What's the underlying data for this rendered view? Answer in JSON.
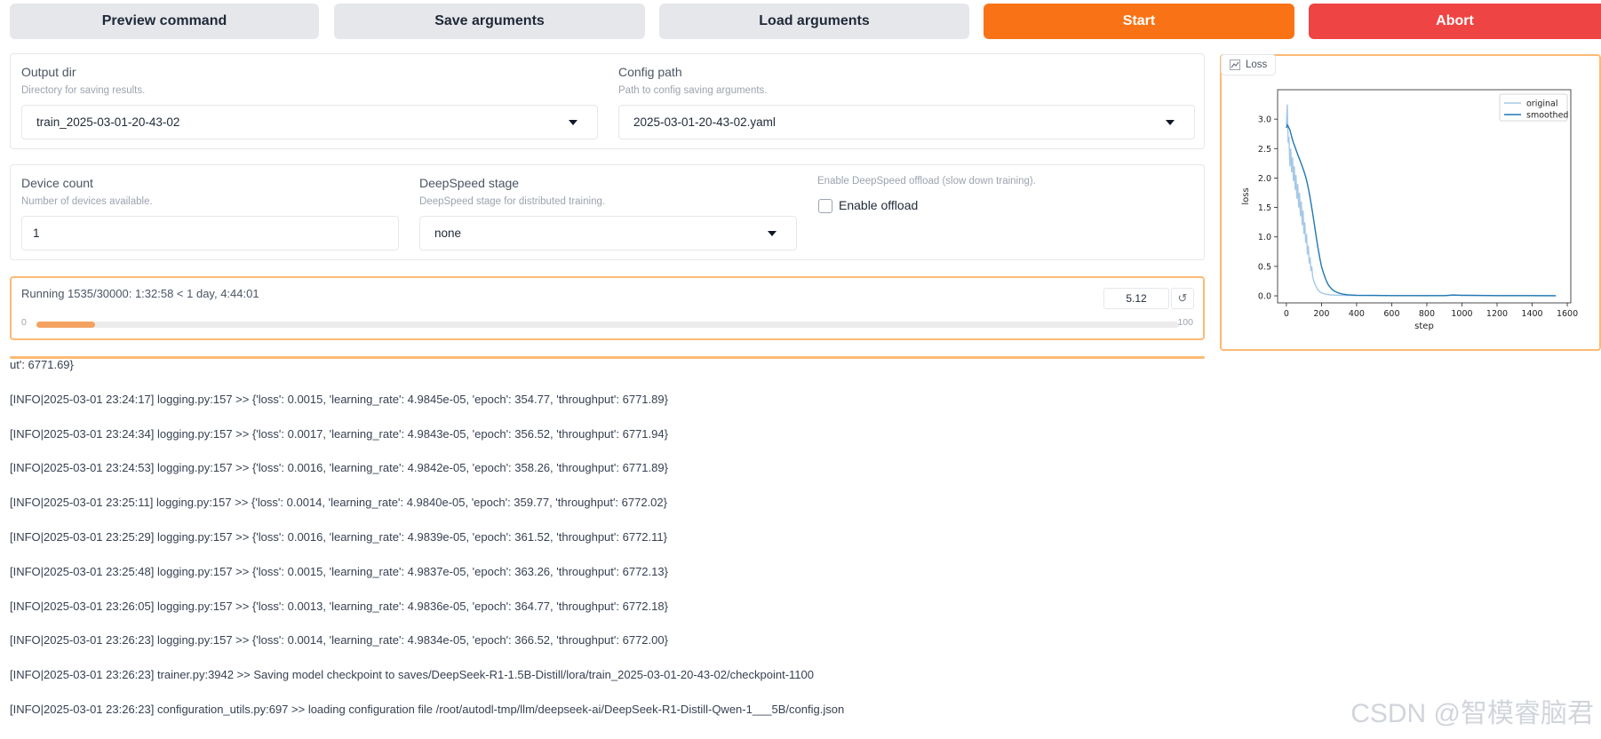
{
  "buttons": {
    "preview": "Preview command",
    "save": "Save arguments",
    "load": "Load arguments",
    "start": "Start",
    "abort": "Abort"
  },
  "output_dir": {
    "label": "Output dir",
    "info": "Directory for saving results.",
    "value": "train_2025-03-01-20-43-02"
  },
  "config_path": {
    "label": "Config path",
    "info": "Path to config saving arguments.",
    "value": "2025-03-01-20-43-02.yaml"
  },
  "device_count": {
    "label": "Device count",
    "info": "Number of devices available.",
    "value": "1"
  },
  "deepspeed_stage": {
    "label": "DeepSpeed stage",
    "info": "DeepSpeed stage for distributed training.",
    "value": "none"
  },
  "offload": {
    "info": "Enable DeepSpeed offload (slow down training).",
    "label": "Enable offload",
    "checked": false
  },
  "progress": {
    "text": "Running 1535/30000: 1:32:58 < 1 day, 4:44:01",
    "min": "0",
    "max": "100",
    "value": "5.12",
    "fraction": 0.0512
  },
  "log_lines": [
    "ut': 6771.69}",
    "[INFO|2025-03-01 23:24:17] logging.py:157 >> {'loss': 0.0015, 'learning_rate': 4.9845e-05, 'epoch': 354.77, 'throughput': 6771.89}",
    "[INFO|2025-03-01 23:24:34] logging.py:157 >> {'loss': 0.0017, 'learning_rate': 4.9843e-05, 'epoch': 356.52, 'throughput': 6771.94}",
    "[INFO|2025-03-01 23:24:53] logging.py:157 >> {'loss': 0.0016, 'learning_rate': 4.9842e-05, 'epoch': 358.26, 'throughput': 6771.89}",
    "[INFO|2025-03-01 23:25:11] logging.py:157 >> {'loss': 0.0014, 'learning_rate': 4.9840e-05, 'epoch': 359.77, 'throughput': 6772.02}",
    "[INFO|2025-03-01 23:25:29] logging.py:157 >> {'loss': 0.0016, 'learning_rate': 4.9839e-05, 'epoch': 361.52, 'throughput': 6772.11}",
    "[INFO|2025-03-01 23:25:48] logging.py:157 >> {'loss': 0.0015, 'learning_rate': 4.9837e-05, 'epoch': 363.26, 'throughput': 6772.13}",
    "[INFO|2025-03-01 23:26:05] logging.py:157 >> {'loss': 0.0013, 'learning_rate': 4.9836e-05, 'epoch': 364.77, 'throughput': 6772.18}",
    "[INFO|2025-03-01 23:26:23] logging.py:157 >> {'loss': 0.0014, 'learning_rate': 4.9834e-05, 'epoch': 366.52, 'throughput': 6772.00}",
    "[INFO|2025-03-01 23:26:23] trainer.py:3942 >> Saving model checkpoint to saves/DeepSeek-R1-1.5B-Distill/lora/train_2025-03-01-20-43-02/checkpoint-1100",
    "[INFO|2025-03-01 23:26:23] configuration_utils.py:697 >> loading configuration file /root/autodl-tmp/llm/deepseek-ai/DeepSeek-R1-Distill-Qwen-1___5B/config.json"
  ],
  "plot": {
    "label": "Loss",
    "icon": "line-chart-icon"
  },
  "chart_data": {
    "type": "line",
    "title": "",
    "xlabel": "step",
    "ylabel": "loss",
    "xlim": [
      -50,
      1620
    ],
    "ylim": [
      -0.12,
      3.5
    ],
    "xticks": [
      0,
      200,
      400,
      600,
      800,
      1000,
      1200,
      1400,
      1600
    ],
    "yticks": [
      0.0,
      0.5,
      1.0,
      1.5,
      2.0,
      2.5,
      3.0
    ],
    "legend_position": "top-right",
    "series": [
      {
        "name": "original",
        "color": "#a6c8e6",
        "x": [
          0,
          5,
          10,
          15,
          20,
          25,
          30,
          35,
          40,
          45,
          50,
          55,
          60,
          65,
          70,
          75,
          80,
          85,
          90,
          95,
          100,
          105,
          110,
          115,
          120,
          125,
          130,
          135,
          140,
          145,
          150,
          160,
          170,
          180,
          190,
          200,
          220,
          250,
          300,
          400,
          600,
          800,
          900,
          950,
          1000,
          1200,
          1400,
          1535
        ],
        "y": [
          2.9,
          3.25,
          2.6,
          2.7,
          2.2,
          2.5,
          2.1,
          2.35,
          1.95,
          2.2,
          1.8,
          2.05,
          1.65,
          1.9,
          1.5,
          1.75,
          1.35,
          1.6,
          1.2,
          1.45,
          1.05,
          1.25,
          0.9,
          1.05,
          0.7,
          0.85,
          0.55,
          0.65,
          0.42,
          0.5,
          0.32,
          0.22,
          0.15,
          0.1,
          0.07,
          0.05,
          0.03,
          0.015,
          0.01,
          0.005,
          0.003,
          0.002,
          0.002,
          0.015,
          0.005,
          0.002,
          0.002,
          0.0015
        ]
      },
      {
        "name": "smoothed",
        "color": "#1f77b4",
        "x": [
          0,
          5,
          10,
          20,
          30,
          40,
          50,
          60,
          70,
          80,
          90,
          100,
          110,
          120,
          130,
          140,
          150,
          160,
          170,
          180,
          190,
          200,
          210,
          220,
          230,
          240,
          260,
          280,
          300,
          320,
          350,
          400,
          500,
          600,
          800,
          900,
          950,
          1000,
          1200,
          1400,
          1535
        ],
        "y": [
          2.85,
          2.9,
          2.88,
          2.82,
          2.7,
          2.6,
          2.52,
          2.44,
          2.36,
          2.28,
          2.2,
          2.12,
          2.02,
          1.9,
          1.75,
          1.58,
          1.4,
          1.2,
          1.0,
          0.82,
          0.65,
          0.5,
          0.4,
          0.31,
          0.24,
          0.18,
          0.11,
          0.07,
          0.045,
          0.03,
          0.018,
          0.01,
          0.006,
          0.004,
          0.003,
          0.003,
          0.012,
          0.01,
          0.004,
          0.003,
          0.002
        ]
      }
    ]
  },
  "watermark": "CSDN @智模睿脑君"
}
